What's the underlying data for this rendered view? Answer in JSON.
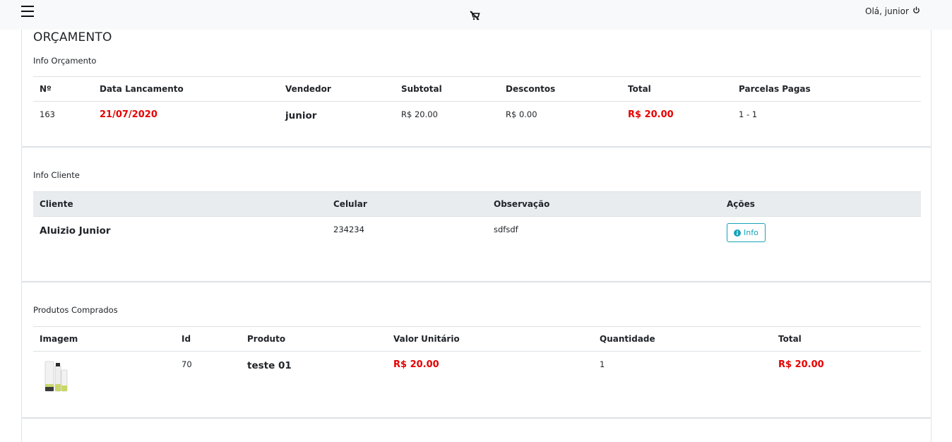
{
  "header": {
    "greeting": "Olá, junior",
    "menu_icon": "hamburger-menu-icon",
    "cart_icon": "cart-off-icon",
    "logout_icon": "power-icon"
  },
  "orcamento": {
    "title": "ORÇAMENTO",
    "section_label": "Info Orçamento",
    "columns": [
      "Nº",
      "Data Lancamento",
      "Vendedor",
      "Subtotal",
      "Descontos",
      "Total",
      "Parcelas Pagas"
    ],
    "row": {
      "numero": "163",
      "data": "21/07/2020",
      "vendedor": "junior",
      "subtotal": "R$ 20.00",
      "descontos": "R$ 0.00",
      "total": "R$ 20.00",
      "parcelas": "1 - 1"
    }
  },
  "cliente": {
    "section_label": "Info Cliente",
    "columns": [
      "Cliente",
      "Celular",
      "Observação",
      "Ações"
    ],
    "row": {
      "nome": "Aluizio Junior",
      "celular": "234234",
      "observacao": "sdfsdf",
      "info_button": "Info"
    }
  },
  "produtos": {
    "section_label": "Produtos Comprados",
    "columns": [
      "Imagem",
      "Id",
      "Produto",
      "Valor Unitário",
      "Quantidade",
      "Total"
    ],
    "rows": [
      {
        "id": "70",
        "produto": "teste 01",
        "valor_unitario": "R$ 20.00",
        "quantidade": "1",
        "total": "R$ 20.00"
      }
    ]
  },
  "colors": {
    "accent_red": "#e60000",
    "info_teal": "#17a2b8",
    "header_bg": "#f8f9fb",
    "table_head_gray": "#e9ecef"
  }
}
